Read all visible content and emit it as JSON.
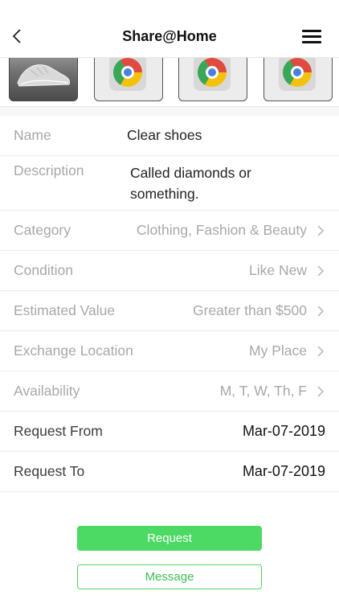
{
  "header": {
    "title": "Share@Home"
  },
  "fields": {
    "name": {
      "label": "Name",
      "value": "Clear shoes"
    },
    "description": {
      "label": "Description",
      "value": "Called diamonds or something."
    },
    "category": {
      "label": "Category",
      "value": "Clothing, Fashion & Beauty"
    },
    "condition": {
      "label": "Condition",
      "value": "Like New"
    },
    "estimated_value": {
      "label": "Estimated Value",
      "value": "Greater than $500"
    },
    "exchange_location": {
      "label": "Exchange Location",
      "value": "My Place"
    },
    "availability": {
      "label": "Availability",
      "value": "M, T, W, Th, F"
    },
    "request_from": {
      "label": "Request From",
      "value": "Mar-07-2019"
    },
    "request_to": {
      "label": "Request To",
      "value": "Mar-07-2019"
    }
  },
  "actions": {
    "request_label": "Request",
    "message_label": "Message"
  },
  "colors": {
    "accent_green": "#4cd964",
    "muted_text": "#a8a8a8"
  },
  "icons": {
    "back": "chevron-left-icon",
    "menu": "hamburger-menu-icon",
    "row_chevron": "chevron-right-icon",
    "placeholder": "chrome-logo-icon"
  }
}
